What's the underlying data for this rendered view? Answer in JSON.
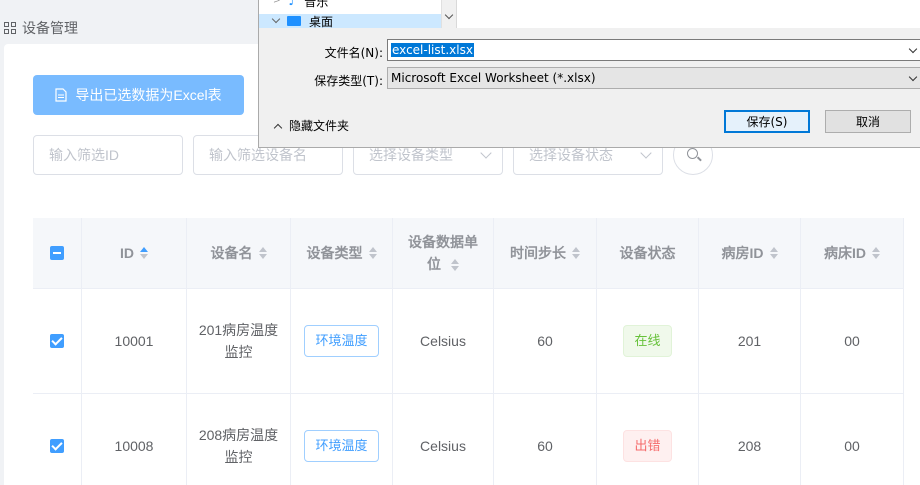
{
  "page": {
    "title": "设备管理"
  },
  "toolbar": {
    "export_label": "导出已选数据为Excel表"
  },
  "filters": {
    "id_placeholder": "输入筛选ID",
    "name_placeholder": "输入筛选设备名",
    "type_placeholder": "选择设备类型",
    "status_placeholder": "选择设备状态"
  },
  "table": {
    "headers": [
      "ID",
      "设备名",
      "设备类型",
      "设备数据单位",
      "时间步长",
      "设备状态",
      "病房ID",
      "病床ID"
    ],
    "rows": [
      {
        "id": "10001",
        "name": "201病房温度监控",
        "type": "环境温度",
        "unit": "Celsius",
        "step": "60",
        "status": "在线",
        "room": "201",
        "bed": "00"
      },
      {
        "id": "10008",
        "name": "208病房温度监控",
        "type": "环境温度",
        "unit": "Celsius",
        "step": "60",
        "status": "出错",
        "room": "208",
        "bed": "00"
      }
    ]
  },
  "save_dialog": {
    "tree_items": [
      "音乐",
      "桌面"
    ],
    "filename_label": "文件名(N):",
    "filename_value": "excel-list.xlsx",
    "filetype_label": "保存类型(T):",
    "filetype_value": "Microsoft Excel Worksheet (*.xlsx)",
    "hide_folders_label": "隐藏文件夹",
    "save_label": "保存(S)",
    "cancel_label": "取消"
  },
  "colors": {
    "primary": "#409eff",
    "export_button": "#79bbff",
    "online": "#67c23a",
    "error": "#f56c6c",
    "selection": "#0078d7"
  }
}
